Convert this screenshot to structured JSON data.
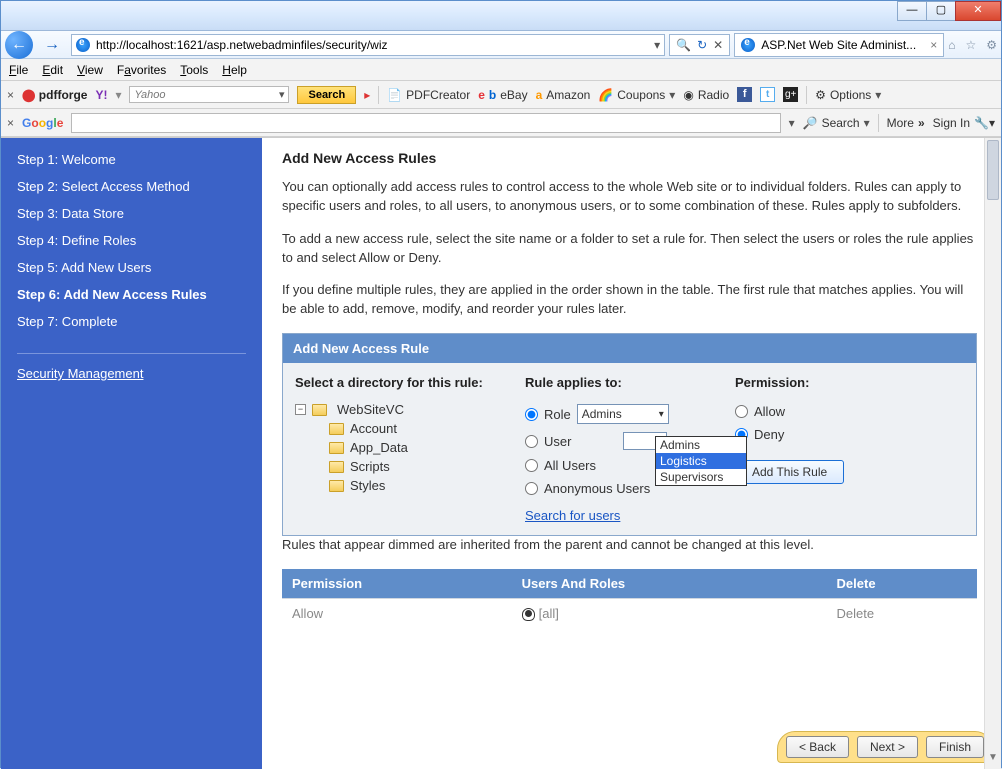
{
  "titlebar": {},
  "nav": {
    "url": "http://localhost:1621/asp.netwebadminfiles/security/wiz",
    "tab_title": "ASP.Net Web Site Administ..."
  },
  "menu": {
    "file": "File",
    "edit": "Edit",
    "view": "View",
    "favorites": "Favorites",
    "tools": "Tools",
    "help": "Help"
  },
  "tb1": {
    "pdfforge": "pdfforge",
    "yahoo_placeholder": "Yahoo",
    "search": "Search",
    "pdfcreator": "PDFCreator",
    "ebay": "eBay",
    "amazon": "Amazon",
    "coupons": "Coupons",
    "radio": "Radio",
    "options": "Options"
  },
  "tb2": {
    "google": "Google",
    "search": "Search",
    "more": "More",
    "signin": "Sign In"
  },
  "sidebar": {
    "steps": [
      "Step 1: Welcome",
      "Step 2: Select Access Method",
      "Step 3: Data Store",
      "Step 4: Define Roles",
      "Step 5: Add New Users",
      "Step 6: Add New Access Rules",
      "Step 7: Complete"
    ],
    "active_index": 5,
    "security_mgmt": "Security Management"
  },
  "content": {
    "title": "Add New Access Rules",
    "p1": "You can optionally add access rules to control access to the whole Web site or to individual folders. Rules can apply to specific users and roles, to all users, to anonymous users, or to some combination of these. Rules apply to subfolders.",
    "p2": "To add a new access rule, select the site name or a folder to set a rule for. Then select the users or roles the rule applies to and select Allow or Deny.",
    "p3": "If you define multiple rules, they are applied in the order shown in the table. The first rule that matches applies. You will be able to add, remove, modify, and reorder your rules later."
  },
  "panel": {
    "header": "Add New Access Rule",
    "dir_label": "Select a directory for this rule:",
    "tree_root": "WebSiteVC",
    "tree_children": [
      "Account",
      "App_Data",
      "Scripts",
      "Styles"
    ],
    "applies_label": "Rule applies to:",
    "role_label": "Role",
    "user_label": "User",
    "allusers_label": "All Users",
    "anon_label": "Anonymous Users",
    "role_selected": "Admins",
    "role_options": [
      "Admins",
      "Logistics",
      "Supervisors"
    ],
    "role_highlight_index": 1,
    "search_users": "Search for users",
    "perm_label": "Permission:",
    "allow": "Allow",
    "deny": "Deny",
    "add_rule": "Add This Rule"
  },
  "below_note": "Rules that appear dimmed are inherited from the parent and cannot be changed at this level.",
  "table": {
    "h1": "Permission",
    "h2": "Users And Roles",
    "h3": "Delete",
    "r1": {
      "perm": "Allow",
      "target": "[all]",
      "del": "Delete"
    }
  },
  "wizard": {
    "back": "< Back",
    "next": "Next >",
    "finish": "Finish"
  }
}
